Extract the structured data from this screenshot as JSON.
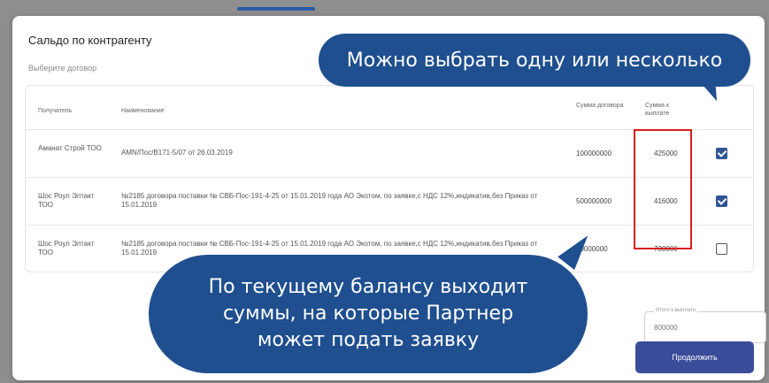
{
  "modal": {
    "title": "Сальдо по контрагенту",
    "subtitle": "Выберите договор"
  },
  "table": {
    "headers": {
      "recipient": "Получатель",
      "name": "Наименование",
      "contract_sum": "Сумма договора",
      "payout_sum": "Сумма к выплате"
    },
    "rows": [
      {
        "recipient": "Аманат Строй ТОО",
        "name": "АМN/Пос/В171-5/07 от 26.03.2019",
        "contract_sum": "100000000",
        "payout_sum": "425000",
        "checked": true
      },
      {
        "recipient": "Шос Роул Элтакт ТОО",
        "name": "№2185 договора поставки № CВБ-Пос-191-4-25 от 15.01.2019 года АО Экотом, по заявке,с НДС 12%,индикатив,без Приказ от 15.01.2019",
        "contract_sum": "500000000",
        "payout_sum": "416000",
        "checked": true
      },
      {
        "recipient": "Шос Роул Элтакт ТОО",
        "name": "№2185 договора поставки № CВБ-Пос-191-4-25 от 15.01.2019 года АО Экотом, по заявке,с НДС 12%,индикатив,без Приказ от 15.01.2019",
        "contract_sum": "50000000",
        "payout_sum": "730000",
        "checked": false
      }
    ]
  },
  "callouts": {
    "top": "Можно выбрать одну или несколько",
    "bottom": [
      "По текущему балансу выходит",
      "суммы, на которые Партнер",
      "может подать заявку"
    ]
  },
  "amount_field": {
    "label": "Итого к выплате",
    "value": "800000"
  },
  "continue_button": {
    "label": "Продолжить"
  },
  "colors": {
    "callout": "#1f4f8f",
    "highlight": "#d62020",
    "button": "#3b4c9a",
    "checkbox_checked": "#2f5496"
  }
}
